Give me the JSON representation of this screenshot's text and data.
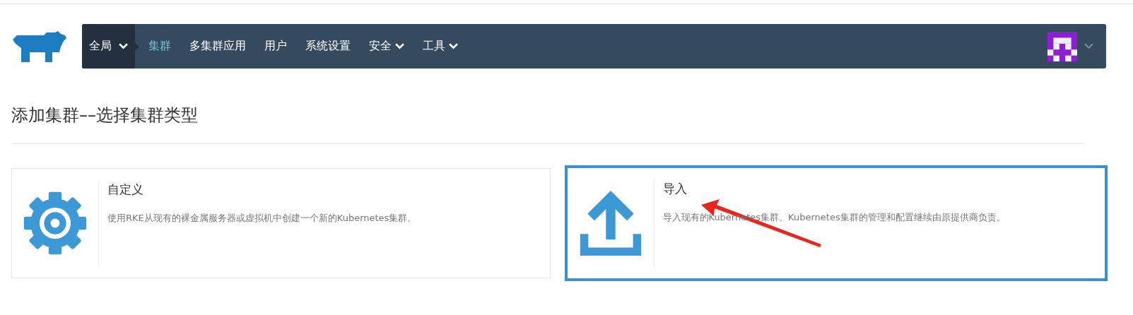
{
  "nav": {
    "scope": {
      "label": "全局"
    },
    "items": [
      {
        "label": "集群",
        "selected": true,
        "has_menu": false
      },
      {
        "label": "多集群应用",
        "selected": false,
        "has_menu": false
      },
      {
        "label": "用户",
        "selected": false,
        "has_menu": false
      },
      {
        "label": "系统设置",
        "selected": false,
        "has_menu": false
      },
      {
        "label": "安全",
        "selected": false,
        "has_menu": true
      },
      {
        "label": "工具",
        "selected": false,
        "has_menu": true
      }
    ]
  },
  "page_title": "添加集群––选择集群类型",
  "cards": [
    {
      "kind": "gear",
      "title": "自定义",
      "description": "使用RKE从现有的裸金属服务器或虚拟机中创建一个新的Kubernetes集群。",
      "highlighted": false
    },
    {
      "kind": "upload",
      "title": "导入",
      "description": "导入现有的Kubernetes集群。Kubernetes集群的管理和配置继续由原提供商负责。",
      "highlighted": true
    }
  ]
}
